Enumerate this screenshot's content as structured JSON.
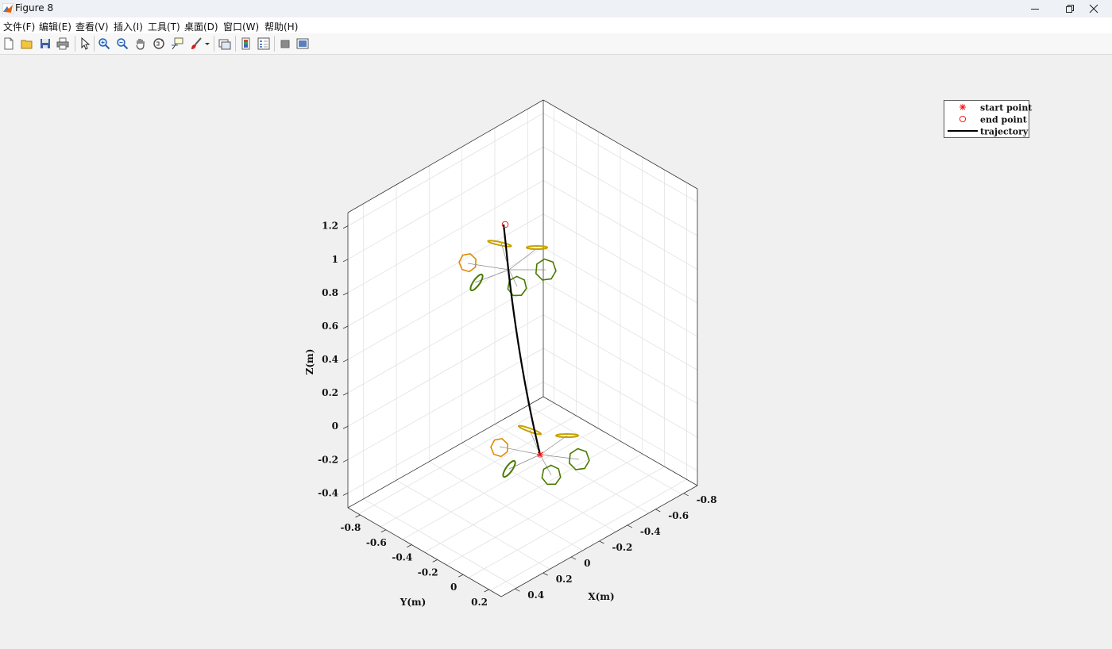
{
  "window": {
    "title": "Figure 8"
  },
  "menu": [
    "文件(F)",
    "编辑(E)",
    "查看(V)",
    "插入(I)",
    "工具(T)",
    "桌面(D)",
    "窗口(W)",
    "帮助(H)"
  ],
  "toolbar": [
    "new-figure",
    "open-file",
    "save",
    "print",
    "select-pointer",
    "zoom-in",
    "zoom-out",
    "pan",
    "rotate-3d",
    "data-cursor",
    "brush",
    "link-plot",
    "colorbar",
    "legend",
    "hide-plot-tools",
    "show-plot-tools"
  ],
  "chart_data": {
    "type": "line3d",
    "xlabel": "X(m)",
    "ylabel": "Y(m)",
    "zlabel": "Z(m)",
    "x_ticks": [
      "-0.8",
      "-0.6",
      "-0.4",
      "-0.2",
      "0",
      "0.2",
      "0.4"
    ],
    "y_ticks": [
      "-0.8",
      "-0.6",
      "-0.4",
      "-0.2",
      "0",
      "0.2"
    ],
    "z_ticks": [
      "-0.4",
      "-0.2",
      "0",
      "0.2",
      "0.4",
      "0.6",
      "0.8",
      "1",
      "1.2"
    ],
    "grid": true,
    "legend_position": "top-right",
    "series": [
      {
        "name": "start point",
        "marker": "asterisk",
        "color": "#ff0000"
      },
      {
        "name": "end point",
        "marker": "circle",
        "color": "#ff0000"
      },
      {
        "name": "trajectory",
        "line": "solid",
        "color": "#000000"
      }
    ],
    "colors": {
      "rotor_front": "#e08a00",
      "rotor_rear": "#4a7a00",
      "rotor_side": "#c8a000",
      "frame": "#888888"
    }
  }
}
